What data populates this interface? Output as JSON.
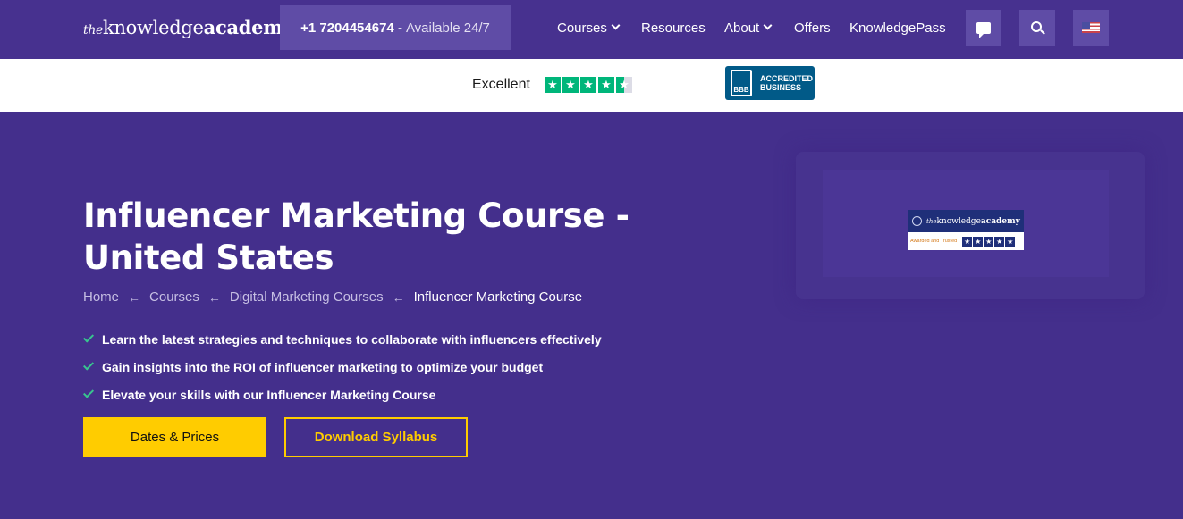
{
  "header": {
    "logo": {
      "prefix": "the",
      "part1": "knowledge",
      "part2": "academy"
    },
    "phone": {
      "number": "+1 7204454674 -",
      "availability": "Available 24/7"
    },
    "nav": [
      {
        "label": "Courses",
        "has_dropdown": true
      },
      {
        "label": "Resources",
        "has_dropdown": false
      },
      {
        "label": "About",
        "has_dropdown": true
      },
      {
        "label": "Offers",
        "has_dropdown": false
      },
      {
        "label": "KnowledgePass",
        "has_dropdown": false
      }
    ],
    "icons": [
      "chat-icon",
      "search-icon",
      "us-flag-icon"
    ]
  },
  "rating_bar": {
    "rating_label": "Excellent",
    "trustpilot_stars": 4.5,
    "bbb": {
      "mark": "BBB",
      "line1": "ACCREDITED",
      "line2": "BUSINESS"
    }
  },
  "hero": {
    "title": "Influencer Marketing Course - United States",
    "breadcrumb": [
      "Home",
      "Courses",
      "Digital Marketing Courses",
      "Influencer Marketing Course"
    ],
    "features": [
      "Learn the latest strategies and techniques to collaborate with influencers effectively",
      "Gain insights into the ROI of influencer marketing to optimize your budget",
      "Elevate your skills with our Influencer Marketing Course"
    ],
    "primary_button": "Dates & Prices",
    "secondary_button": "Download Syllabus"
  },
  "card": {
    "logo": {
      "prefix": "the",
      "part1": "knowledge",
      "part2": "academy"
    },
    "awarded": "Awarded and Trusted",
    "stars": 5
  },
  "colors": {
    "background": "#442f8c",
    "header": "#47318f",
    "accent": "#ffcc00",
    "check": "#38c68f",
    "trustpilot": "#00b67a"
  }
}
